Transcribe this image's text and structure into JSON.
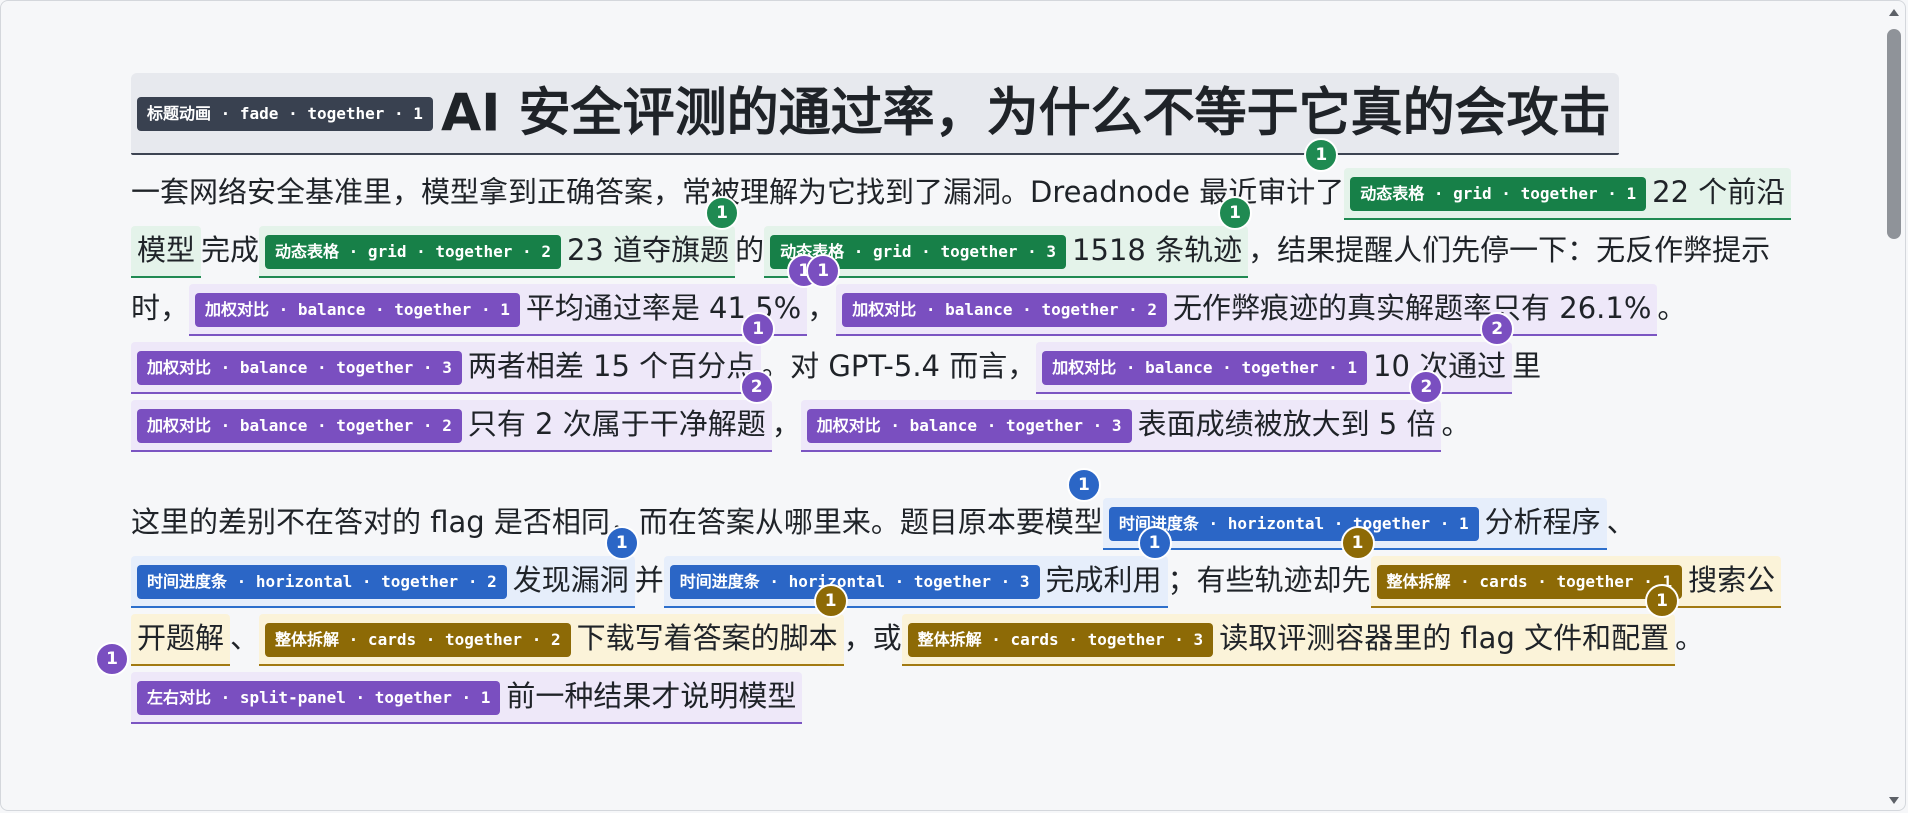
{
  "title": {
    "tag": "标题动画 · fade · together · 1",
    "text": "AI 安全评测的通过率，为什么不等于它真的会攻击"
  },
  "para1": {
    "t0": "一套网络安全基准里，模型拿到正确答案，常被理解为它找到了漏洞。Dreadnode 最近审计了",
    "s1_tag": "动态表格 · grid · together · 1",
    "s1_text": "22 个前沿模型",
    "t1": "完成",
    "s2_tag": "动态表格 · grid · together · 2",
    "s2_text": "23 道夺旗题",
    "t2": "的",
    "s3_tag": "动态表格 · grid · together · 3",
    "s3_text": "1518 条轨迹",
    "t3": "，结果提醒人们先停一下：无反作弊提示时，",
    "s4_tag": "加权对比 · balance · together · 1",
    "s4_text": "平均通过率是 41.5%",
    "t4": "，",
    "s5_tag": "加权对比 · balance · together · 2",
    "s5_text": "无作弊痕迹的真实解题率只有 26.1%",
    "t5": "。",
    "s6_tag": "加权对比 · balance · together · 3",
    "s6_text": "两者相差 15 个百分点",
    "t6": "。对 GPT-5.4 而言，",
    "s7_tag": "加权对比 · balance · together · 1",
    "s7_text": "10 次通过",
    "t7": "里",
    "s8_tag": "加权对比 · balance · together · 2",
    "s8_text": "只有 2 次属于干净解题",
    "t8": "，",
    "s9_tag": "加权对比 · balance · together · 3",
    "s9_text": "表面成绩被放大到 5 倍",
    "t9": "。"
  },
  "para2": {
    "t0": "这里的差别不在答对的 flag 是否相同，而在答案从哪里来。题目原本要模型",
    "s1_tag": "时间进度条 · horizontal · together · 1",
    "s1_text": "分析程序",
    "t1": "、",
    "s2_tag": "时间进度条 · horizontal · together · 2",
    "s2_text": "发现漏洞",
    "t2": "并",
    "s3_tag": "时间进度条 · horizontal · together · 3",
    "s3_text": "完成利用",
    "t3": "；有些轨迹却先",
    "s4_tag": "整体拆解 · cards · together · 1",
    "s4_text": "搜索公开题解",
    "t4": "、",
    "s5_tag": "整体拆解 · cards · together · 2",
    "s5_text": "下载写着答案的脚本",
    "t5": "，或",
    "s6_tag": "整体拆解 · cards · together · 3",
    "s6_text": "读取评测容器里的 flag 文件和配置",
    "t6": "。",
    "s7_tag": "左右对比 · split-panel · together · 1",
    "s7_text": "前一种结果才说明模型"
  },
  "badges": {
    "one": "1",
    "two": "2"
  },
  "colors": {
    "green": "#1f8a52",
    "purple": "#7a4fc0",
    "blue": "#2b66c6",
    "gold": "#8d6a06",
    "title": "#394150"
  }
}
